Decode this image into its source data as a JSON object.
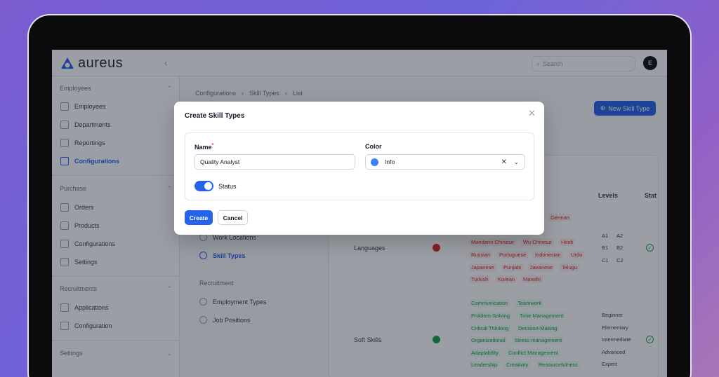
{
  "app": {
    "name": "aureus",
    "search_placeholder": "Search",
    "avatar_initial": "E"
  },
  "sidebar": {
    "groups": [
      {
        "label": "Employees",
        "items": [
          "Employees",
          "Departments",
          "Reportings",
          "Configurations"
        ]
      },
      {
        "label": "Purchase",
        "items": [
          "Orders",
          "Products",
          "Configurations",
          "Settings"
        ]
      },
      {
        "label": "Recruitments",
        "items": [
          "Applications",
          "Configuration"
        ]
      },
      {
        "label": "Settings",
        "items": []
      }
    ],
    "active": "Configurations"
  },
  "breadcrumb": [
    "Configurations",
    "Skill Types",
    "List"
  ],
  "new_button": "New Skill Type",
  "subnav": {
    "items": [
      "Work Locations",
      "Skill Types"
    ],
    "group": "Recruitment",
    "group_items": [
      "Employment Types",
      "Job Positions"
    ]
  },
  "table": {
    "columns": [
      "Levels",
      "Stat"
    ],
    "rows": [
      {
        "name": "Languages",
        "color": "#dc2626",
        "tags": [
          "German",
          "Mandarin Chinese",
          "Wu Chinese",
          "Hindi",
          "Russian",
          "Portuguese",
          "Indonesian",
          "Urdu",
          "Japanese",
          "Punjabi",
          "Javanese",
          "Telugu",
          "Turkish",
          "Korean",
          "Marathi"
        ],
        "levels": [
          "A1",
          "A2",
          "B1",
          "B2",
          "C1",
          "C2"
        ]
      },
      {
        "name": "Soft Skills",
        "color": "#16a34a",
        "tags": [
          "Communication",
          "Teamwork",
          "Problem-Solving",
          "Time Management",
          "Critical Thinking",
          "Decision-Making",
          "Organizational",
          "Stress management",
          "Adaptability",
          "Conflict Management",
          "Leadership",
          "Creativity",
          "Resourcefulness"
        ],
        "levels": [
          "Beginner",
          "Elementary",
          "Intermediate",
          "Advanced",
          "Expert"
        ]
      }
    ]
  },
  "modal": {
    "title": "Create Skill Types",
    "name_label": "Name",
    "name_value": "Quality Analyst",
    "color_label": "Color",
    "color_value": "Info",
    "color_swatch": "#3b82f6",
    "status_label": "Status",
    "create": "Create",
    "cancel": "Cancel"
  }
}
